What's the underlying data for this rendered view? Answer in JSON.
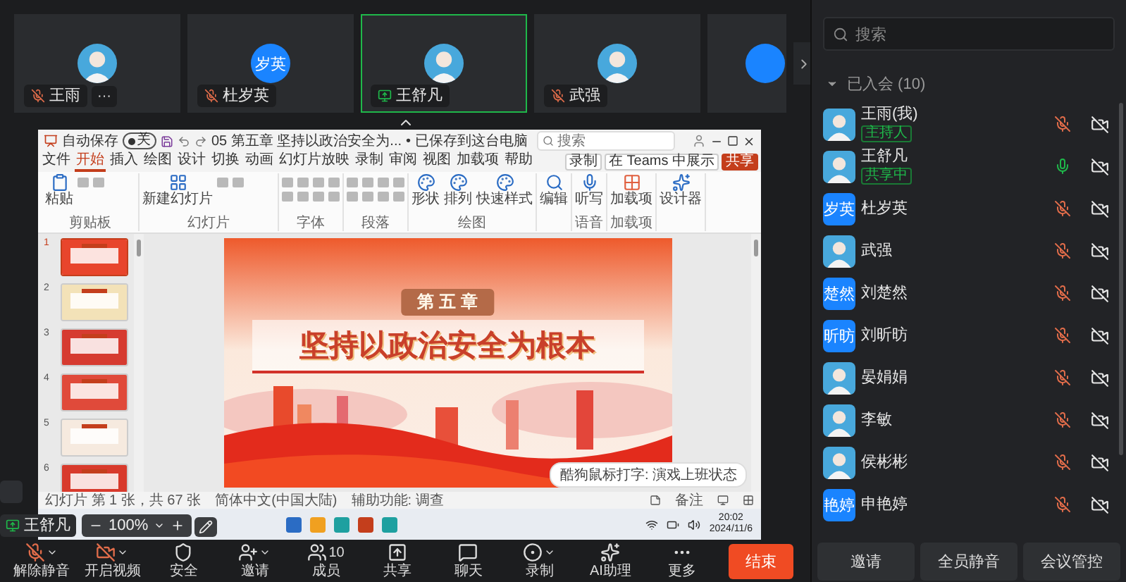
{
  "video_strip": {
    "tiles": [
      {
        "kind": "muted",
        "name": "王雨",
        "avatar": {
          "kind": "photo"
        },
        "selected": false,
        "more": "···"
      },
      {
        "kind": "muted",
        "name": "杜岁英",
        "avatar": {
          "kind": "initials",
          "text": "岁英"
        },
        "selected": false
      },
      {
        "kind": "sharing",
        "name": "王舒凡",
        "avatar": {
          "kind": "photo"
        },
        "selected": true
      },
      {
        "kind": "muted",
        "name": "武强",
        "avatar": {
          "kind": "photo"
        },
        "selected": false
      },
      {
        "kind": "partial",
        "avatar": {
          "kind": "plain"
        },
        "selected": false
      }
    ]
  },
  "shared_screen": {
    "titlebar": {
      "autosave": "自动保存",
      "autosave_toggle": "关",
      "file": "05 第五章 坚持以政治安全为...",
      "saved": "• 已保存到这台电脑",
      "search": "搜索"
    },
    "menu": [
      {
        "label": "文件",
        "selected": false
      },
      {
        "label": "开始",
        "selected": true
      },
      {
        "label": "插入",
        "selected": false
      },
      {
        "label": "绘图",
        "selected": false
      },
      {
        "label": "设计",
        "selected": false
      },
      {
        "label": "切换",
        "selected": false
      },
      {
        "label": "动画",
        "selected": false
      },
      {
        "label": "幻灯片放映",
        "selected": false
      },
      {
        "label": "录制",
        "selected": false
      },
      {
        "label": "审阅",
        "selected": false
      },
      {
        "label": "视图",
        "selected": false
      },
      {
        "label": "加载项",
        "selected": false
      },
      {
        "label": "帮助",
        "selected": false
      }
    ],
    "menu_right": {
      "record": "录制",
      "teams": "在 Teams 中展示",
      "share": "共享"
    },
    "ribbon": [
      {
        "label": "剪贴板",
        "buttons": [
          "粘贴"
        ]
      },
      {
        "label": "幻灯片",
        "buttons": [
          "新建幻灯片"
        ]
      },
      {
        "label": "字体"
      },
      {
        "label": "段落"
      },
      {
        "label": "绘图",
        "buttons": [
          "形状",
          "排列",
          "快速样式"
        ]
      },
      {
        "buttons": [
          "编辑"
        ]
      },
      {
        "label": "语音",
        "buttons": [
          "听写"
        ]
      },
      {
        "label": "加载项",
        "buttons": [
          "加载项"
        ]
      },
      {
        "buttons": [
          "设计器"
        ]
      }
    ],
    "thumbnails": [
      {
        "number": "1",
        "selected": true
      },
      {
        "number": "2",
        "selected": false
      },
      {
        "number": "3",
        "selected": false
      },
      {
        "number": "4",
        "selected": false
      },
      {
        "number": "5",
        "selected": false
      },
      {
        "number": "6",
        "selected": false
      }
    ],
    "slide": {
      "chapter": "第 五 章",
      "title": "坚持以政治安全为根本"
    },
    "ime_popup": "酷狗鼠标打字: 演戏上班状态",
    "status_bar": {
      "slide_count": "幻灯片 第 1 张，共 67 张",
      "language": "简体中文(中国大陆)",
      "accessibility": "辅助功能: 调查",
      "notes": "备注"
    },
    "taskbar": {
      "time": "20:02",
      "date": "2024/11/6"
    }
  },
  "presenter": {
    "name": "王舒凡",
    "zoom": "100%"
  },
  "toolbar": [
    {
      "label": "解除静音",
      "menu": true
    },
    {
      "label": "开启视频",
      "menu": true
    },
    {
      "label": "安全",
      "menu": false
    },
    {
      "label": "邀请",
      "menu": true
    },
    {
      "label": "成员",
      "count": "10",
      "menu": false
    },
    {
      "label": "共享",
      "menu": false
    },
    {
      "label": "聊天",
      "menu": false
    },
    {
      "label": "录制",
      "menu": true
    },
    {
      "label": "AI助理",
      "menu": false
    },
    {
      "label": "更多",
      "menu": false
    }
  ],
  "end_button": "结束",
  "members_panel": {
    "search": {
      "placeholder": "搜索"
    },
    "group": {
      "label": "已入会 (10)",
      "expanded": true
    },
    "members": [
      {
        "name": "王雨(我)",
        "tag": "主持人",
        "avatar": {
          "kind": "photo"
        },
        "muted": true,
        "camera_off": true
      },
      {
        "name": "王舒凡",
        "tag": "共享中",
        "avatar": {
          "kind": "photo"
        },
        "muted": false,
        "camera_off": true
      },
      {
        "name": "杜岁英",
        "avatar": {
          "kind": "initials",
          "text": "岁英"
        },
        "muted": true,
        "camera_off": true
      },
      {
        "name": "武强",
        "avatar": {
          "kind": "photo"
        },
        "muted": true,
        "camera_off": true
      },
      {
        "name": "刘楚然",
        "avatar": {
          "kind": "initials",
          "text": "楚然"
        },
        "muted": true,
        "camera_off": true
      },
      {
        "name": "刘昕昉",
        "avatar": {
          "kind": "initials",
          "text": "昕昉"
        },
        "muted": true,
        "camera_off": true
      },
      {
        "name": "晏娟娟",
        "avatar": {
          "kind": "photo"
        },
        "muted": true,
        "camera_off": true
      },
      {
        "name": "李敏",
        "avatar": {
          "kind": "photo"
        },
        "muted": true,
        "camera_off": true
      },
      {
        "name": "侯彬彬",
        "avatar": {
          "kind": "photo"
        },
        "muted": true,
        "camera_off": true
      },
      {
        "name": "申艳婷",
        "avatar": {
          "kind": "initials",
          "text": "艳婷"
        },
        "muted": true,
        "camera_off": true
      }
    ],
    "footer": [
      "邀请",
      "全员静音",
      "会议管控"
    ]
  }
}
